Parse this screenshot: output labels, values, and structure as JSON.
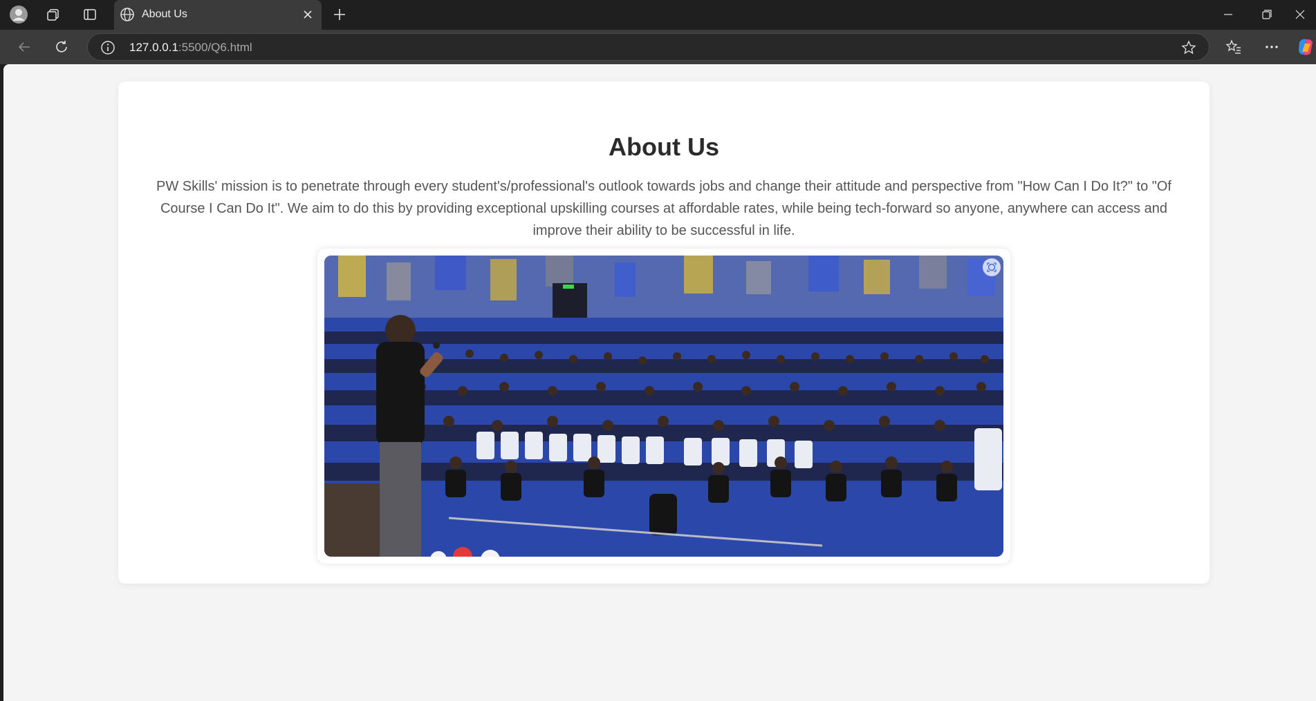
{
  "browser": {
    "tab_title": "About Us",
    "url_host": "127.0.0.1",
    "url_rest": ":5500/Q6.html"
  },
  "page": {
    "heading": "About Us",
    "body": "PW Skills' mission is to penetrate through every student's/professional's outlook towards jobs and change their attitude and perspective from \"How Can I Do It?\" to \"Of Course I Can Do It\". We aim to do this by providing exceptional upskilling courses at affordable rates, while being tech-forward so anyone, anywhere can access and improve their ability to be successful in life."
  },
  "colors": {
    "seats": "#2f4fb5",
    "wall": "#5c6fb3",
    "accent_white": "#ffffff"
  }
}
